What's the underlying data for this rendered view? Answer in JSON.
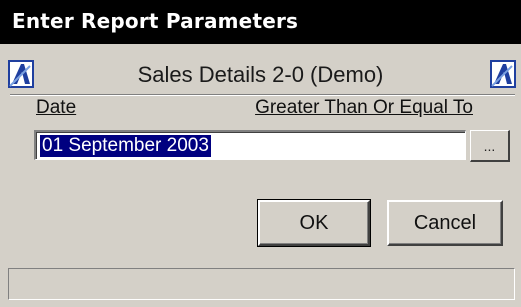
{
  "window": {
    "title": "Enter Report Parameters"
  },
  "report": {
    "title": "Sales Details 2-0 (Demo)"
  },
  "parameter": {
    "field_label": "Date",
    "operator_label": "Greater Than Or Equal To",
    "value": "01 September 2003",
    "browse_label": "..."
  },
  "buttons": {
    "ok_label": "OK",
    "cancel_label": "Cancel"
  },
  "status_bar": {
    "text": ""
  },
  "colors": {
    "titlebar": "#000000",
    "dialog_background": "#d4d0c8",
    "selection_highlight": "#000080",
    "report_icon": "#1f3f9f"
  }
}
